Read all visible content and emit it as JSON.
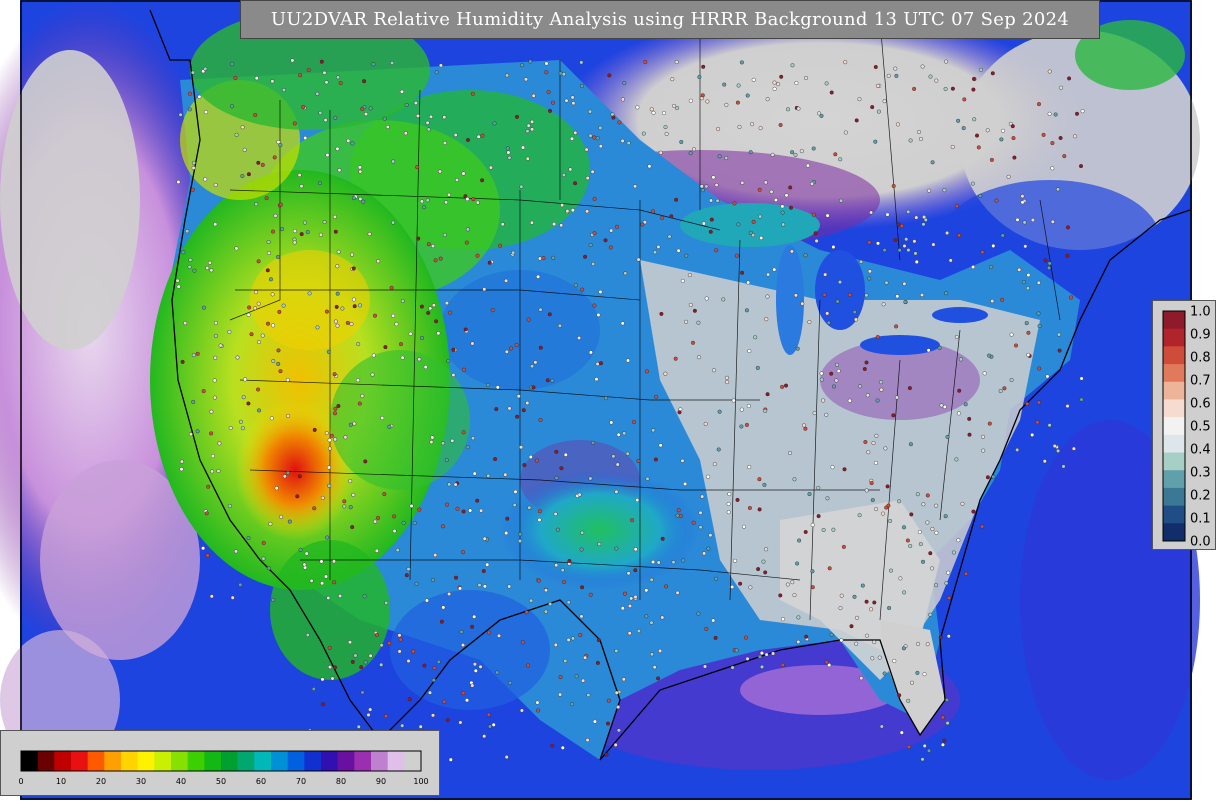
{
  "title": "UU2DVAR Relative Humidity Analysis using HRRR Background 13 UTC 07 Sep 2024",
  "colors": {
    "no_data_gray": "#cccccc",
    "ocean_blue": "#1f3fe0",
    "deep_blue": "#0a1fb4",
    "purple": "#7a2a9a",
    "light_purple": "#d9a8e6",
    "teal": "#2aa4c8",
    "green": "#1bbf2a",
    "lime": "#9be020",
    "yellow": "#f2e200",
    "orange": "#f08a00",
    "red": "#e01010",
    "dark_red": "#8a0000",
    "border_black": "#000000"
  },
  "vertical_legend": {
    "ticks": [
      "1.0",
      "0.9",
      "0.8",
      "0.7",
      "0.6",
      "0.5",
      "0.4",
      "0.3",
      "0.2",
      "0.1",
      "0.0"
    ],
    "colors": [
      "#8e1a2a",
      "#b2242c",
      "#cf4b3a",
      "#e07a5a",
      "#eeb49a",
      "#f6dcd0",
      "#f2f2f2",
      "#dde6ea",
      "#a6cfc6",
      "#5fa0ab",
      "#3a7896",
      "#1f4e86",
      "#122e6a"
    ]
  },
  "horizontal_legend": {
    "ticks": [
      "0",
      "10",
      "20",
      "30",
      "40",
      "50",
      "60",
      "70",
      "80",
      "90",
      "100"
    ],
    "colors": [
      "#000000",
      "#6a0000",
      "#c00000",
      "#e81010",
      "#ff5a00",
      "#ffa000",
      "#ffd400",
      "#fff200",
      "#c8f000",
      "#86e000",
      "#3cd000",
      "#14b814",
      "#00a030",
      "#00a870",
      "#00b8b8",
      "#0090d8",
      "#0060e0",
      "#1030d0",
      "#3010b0",
      "#6a10a0",
      "#9a30b0",
      "#c080d0",
      "#e0c0ea",
      "#d0d0d0"
    ]
  }
}
